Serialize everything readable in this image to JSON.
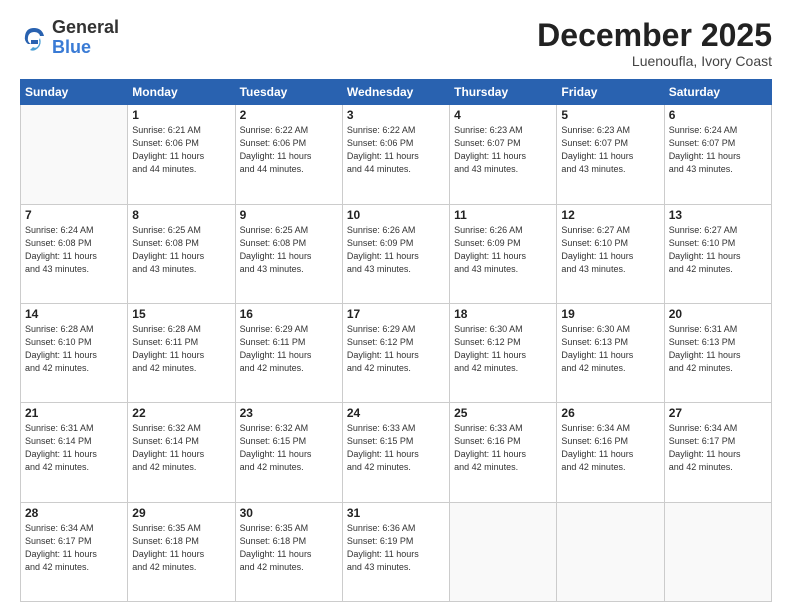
{
  "logo": {
    "general": "General",
    "blue": "Blue"
  },
  "title": "December 2025",
  "location": "Luenoufla, Ivory Coast",
  "weekdays": [
    "Sunday",
    "Monday",
    "Tuesday",
    "Wednesday",
    "Thursday",
    "Friday",
    "Saturday"
  ],
  "weeks": [
    [
      {
        "day": "",
        "info": ""
      },
      {
        "day": "1",
        "info": "Sunrise: 6:21 AM\nSunset: 6:06 PM\nDaylight: 11 hours\nand 44 minutes."
      },
      {
        "day": "2",
        "info": "Sunrise: 6:22 AM\nSunset: 6:06 PM\nDaylight: 11 hours\nand 44 minutes."
      },
      {
        "day": "3",
        "info": "Sunrise: 6:22 AM\nSunset: 6:06 PM\nDaylight: 11 hours\nand 44 minutes."
      },
      {
        "day": "4",
        "info": "Sunrise: 6:23 AM\nSunset: 6:07 PM\nDaylight: 11 hours\nand 43 minutes."
      },
      {
        "day": "5",
        "info": "Sunrise: 6:23 AM\nSunset: 6:07 PM\nDaylight: 11 hours\nand 43 minutes."
      },
      {
        "day": "6",
        "info": "Sunrise: 6:24 AM\nSunset: 6:07 PM\nDaylight: 11 hours\nand 43 minutes."
      }
    ],
    [
      {
        "day": "7",
        "info": "Sunrise: 6:24 AM\nSunset: 6:08 PM\nDaylight: 11 hours\nand 43 minutes."
      },
      {
        "day": "8",
        "info": "Sunrise: 6:25 AM\nSunset: 6:08 PM\nDaylight: 11 hours\nand 43 minutes."
      },
      {
        "day": "9",
        "info": "Sunrise: 6:25 AM\nSunset: 6:08 PM\nDaylight: 11 hours\nand 43 minutes."
      },
      {
        "day": "10",
        "info": "Sunrise: 6:26 AM\nSunset: 6:09 PM\nDaylight: 11 hours\nand 43 minutes."
      },
      {
        "day": "11",
        "info": "Sunrise: 6:26 AM\nSunset: 6:09 PM\nDaylight: 11 hours\nand 43 minutes."
      },
      {
        "day": "12",
        "info": "Sunrise: 6:27 AM\nSunset: 6:10 PM\nDaylight: 11 hours\nand 43 minutes."
      },
      {
        "day": "13",
        "info": "Sunrise: 6:27 AM\nSunset: 6:10 PM\nDaylight: 11 hours\nand 42 minutes."
      }
    ],
    [
      {
        "day": "14",
        "info": "Sunrise: 6:28 AM\nSunset: 6:10 PM\nDaylight: 11 hours\nand 42 minutes."
      },
      {
        "day": "15",
        "info": "Sunrise: 6:28 AM\nSunset: 6:11 PM\nDaylight: 11 hours\nand 42 minutes."
      },
      {
        "day": "16",
        "info": "Sunrise: 6:29 AM\nSunset: 6:11 PM\nDaylight: 11 hours\nand 42 minutes."
      },
      {
        "day": "17",
        "info": "Sunrise: 6:29 AM\nSunset: 6:12 PM\nDaylight: 11 hours\nand 42 minutes."
      },
      {
        "day": "18",
        "info": "Sunrise: 6:30 AM\nSunset: 6:12 PM\nDaylight: 11 hours\nand 42 minutes."
      },
      {
        "day": "19",
        "info": "Sunrise: 6:30 AM\nSunset: 6:13 PM\nDaylight: 11 hours\nand 42 minutes."
      },
      {
        "day": "20",
        "info": "Sunrise: 6:31 AM\nSunset: 6:13 PM\nDaylight: 11 hours\nand 42 minutes."
      }
    ],
    [
      {
        "day": "21",
        "info": "Sunrise: 6:31 AM\nSunset: 6:14 PM\nDaylight: 11 hours\nand 42 minutes."
      },
      {
        "day": "22",
        "info": "Sunrise: 6:32 AM\nSunset: 6:14 PM\nDaylight: 11 hours\nand 42 minutes."
      },
      {
        "day": "23",
        "info": "Sunrise: 6:32 AM\nSunset: 6:15 PM\nDaylight: 11 hours\nand 42 minutes."
      },
      {
        "day": "24",
        "info": "Sunrise: 6:33 AM\nSunset: 6:15 PM\nDaylight: 11 hours\nand 42 minutes."
      },
      {
        "day": "25",
        "info": "Sunrise: 6:33 AM\nSunset: 6:16 PM\nDaylight: 11 hours\nand 42 minutes."
      },
      {
        "day": "26",
        "info": "Sunrise: 6:34 AM\nSunset: 6:16 PM\nDaylight: 11 hours\nand 42 minutes."
      },
      {
        "day": "27",
        "info": "Sunrise: 6:34 AM\nSunset: 6:17 PM\nDaylight: 11 hours\nand 42 minutes."
      }
    ],
    [
      {
        "day": "28",
        "info": "Sunrise: 6:34 AM\nSunset: 6:17 PM\nDaylight: 11 hours\nand 42 minutes."
      },
      {
        "day": "29",
        "info": "Sunrise: 6:35 AM\nSunset: 6:18 PM\nDaylight: 11 hours\nand 42 minutes."
      },
      {
        "day": "30",
        "info": "Sunrise: 6:35 AM\nSunset: 6:18 PM\nDaylight: 11 hours\nand 42 minutes."
      },
      {
        "day": "31",
        "info": "Sunrise: 6:36 AM\nSunset: 6:19 PM\nDaylight: 11 hours\nand 43 minutes."
      },
      {
        "day": "",
        "info": ""
      },
      {
        "day": "",
        "info": ""
      },
      {
        "day": "",
        "info": ""
      }
    ]
  ]
}
